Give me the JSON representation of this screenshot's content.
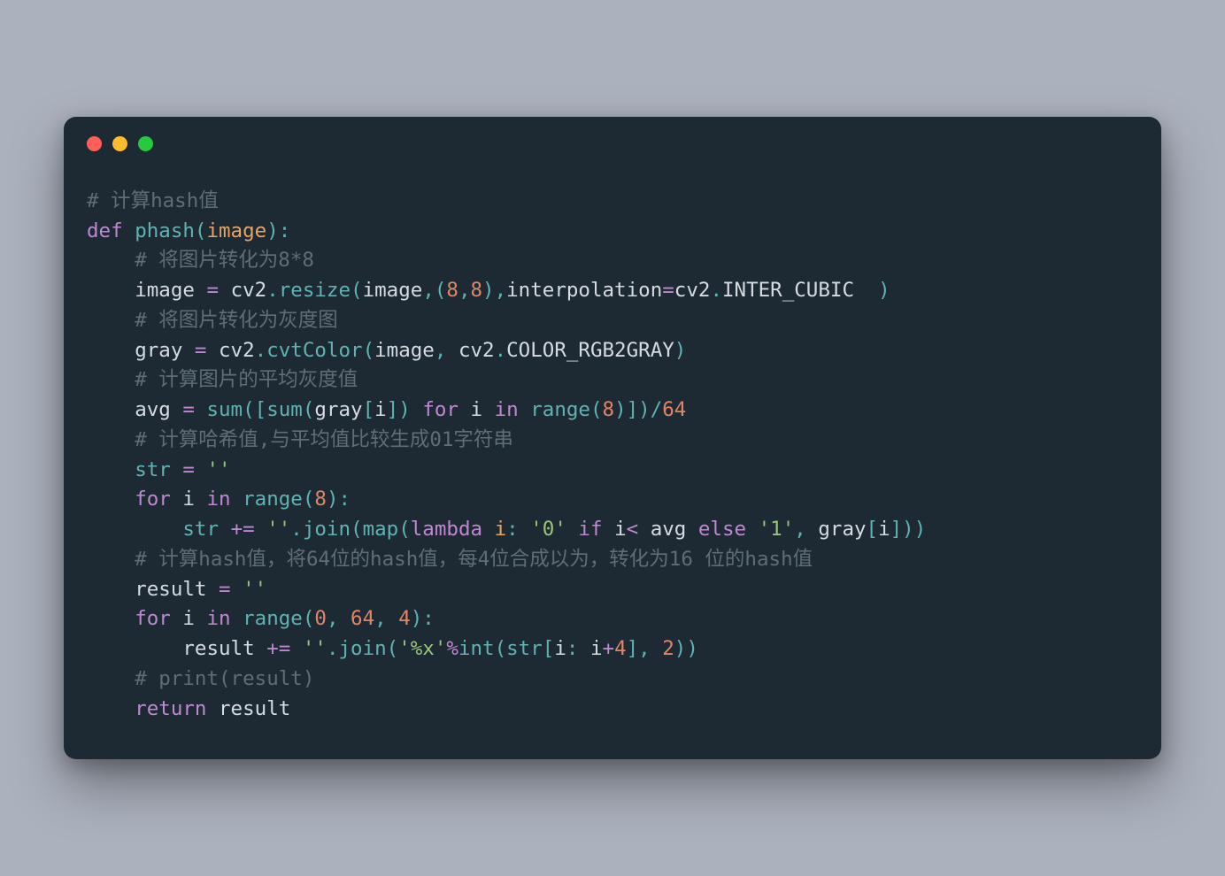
{
  "titlebar": {
    "buttons": [
      "close",
      "minimize",
      "zoom"
    ]
  },
  "code": {
    "lines": [
      [
        {
          "cls": "tok-comment",
          "t": "# 计算hash值"
        }
      ],
      [
        {
          "cls": "tok-keyword",
          "t": "def"
        },
        {
          "cls": "",
          "t": " "
        },
        {
          "cls": "tok-func",
          "t": "phash"
        },
        {
          "cls": "tok-punct",
          "t": "("
        },
        {
          "cls": "tok-param",
          "t": "image"
        },
        {
          "cls": "tok-punct",
          "t": "):"
        }
      ],
      [
        {
          "cls": "",
          "t": "    "
        },
        {
          "cls": "tok-comment",
          "t": "# 将图片转化为8*8"
        }
      ],
      [
        {
          "cls": "",
          "t": "    "
        },
        {
          "cls": "tok-var",
          "t": "image"
        },
        {
          "cls": "",
          "t": " "
        },
        {
          "cls": "tok-op",
          "t": "="
        },
        {
          "cls": "",
          "t": " "
        },
        {
          "cls": "tok-var",
          "t": "cv2"
        },
        {
          "cls": "tok-punct",
          "t": "."
        },
        {
          "cls": "tok-member",
          "t": "resize"
        },
        {
          "cls": "tok-punct",
          "t": "("
        },
        {
          "cls": "tok-var",
          "t": "image"
        },
        {
          "cls": "tok-punct",
          "t": ",("
        },
        {
          "cls": "tok-num",
          "t": "8"
        },
        {
          "cls": "tok-punct",
          "t": ","
        },
        {
          "cls": "tok-num",
          "t": "8"
        },
        {
          "cls": "tok-punct",
          "t": "),"
        },
        {
          "cls": "tok-var",
          "t": "interpolation"
        },
        {
          "cls": "tok-op",
          "t": "="
        },
        {
          "cls": "tok-var",
          "t": "cv2"
        },
        {
          "cls": "tok-punct",
          "t": "."
        },
        {
          "cls": "tok-var",
          "t": "INTER_CUBIC"
        },
        {
          "cls": "",
          "t": "  "
        },
        {
          "cls": "tok-punct",
          "t": ")"
        }
      ],
      [
        {
          "cls": "",
          "t": "    "
        },
        {
          "cls": "tok-comment",
          "t": "# 将图片转化为灰度图"
        }
      ],
      [
        {
          "cls": "",
          "t": "    "
        },
        {
          "cls": "tok-var",
          "t": "gray"
        },
        {
          "cls": "",
          "t": " "
        },
        {
          "cls": "tok-op",
          "t": "="
        },
        {
          "cls": "",
          "t": " "
        },
        {
          "cls": "tok-var",
          "t": "cv2"
        },
        {
          "cls": "tok-punct",
          "t": "."
        },
        {
          "cls": "tok-member",
          "t": "cvtColor"
        },
        {
          "cls": "tok-punct",
          "t": "("
        },
        {
          "cls": "tok-var",
          "t": "image"
        },
        {
          "cls": "tok-punct",
          "t": ", "
        },
        {
          "cls": "tok-var",
          "t": "cv2"
        },
        {
          "cls": "tok-punct",
          "t": "."
        },
        {
          "cls": "tok-var",
          "t": "COLOR_RGB2GRAY"
        },
        {
          "cls": "tok-punct",
          "t": ")"
        }
      ],
      [
        {
          "cls": "",
          "t": "    "
        },
        {
          "cls": "tok-comment",
          "t": "# 计算图片的平均灰度值"
        }
      ],
      [
        {
          "cls": "",
          "t": "    "
        },
        {
          "cls": "tok-var",
          "t": "avg"
        },
        {
          "cls": "",
          "t": " "
        },
        {
          "cls": "tok-op",
          "t": "="
        },
        {
          "cls": "",
          "t": " "
        },
        {
          "cls": "tok-builtin",
          "t": "sum"
        },
        {
          "cls": "tok-punct",
          "t": "(["
        },
        {
          "cls": "tok-builtin",
          "t": "sum"
        },
        {
          "cls": "tok-punct",
          "t": "("
        },
        {
          "cls": "tok-var",
          "t": "gray"
        },
        {
          "cls": "tok-punct",
          "t": "["
        },
        {
          "cls": "tok-var",
          "t": "i"
        },
        {
          "cls": "tok-punct",
          "t": "]) "
        },
        {
          "cls": "tok-keyword",
          "t": "for"
        },
        {
          "cls": "",
          "t": " "
        },
        {
          "cls": "tok-var",
          "t": "i"
        },
        {
          "cls": "",
          "t": " "
        },
        {
          "cls": "tok-keyword",
          "t": "in"
        },
        {
          "cls": "",
          "t": " "
        },
        {
          "cls": "tok-builtin",
          "t": "range"
        },
        {
          "cls": "tok-punct",
          "t": "("
        },
        {
          "cls": "tok-num",
          "t": "8"
        },
        {
          "cls": "tok-punct",
          "t": ")])/"
        },
        {
          "cls": "tok-num",
          "t": "64"
        }
      ],
      [
        {
          "cls": "",
          "t": "    "
        },
        {
          "cls": "tok-comment",
          "t": "# 计算哈希值,与平均值比较生成01字符串"
        }
      ],
      [
        {
          "cls": "",
          "t": "    "
        },
        {
          "cls": "tok-builtin",
          "t": "str"
        },
        {
          "cls": "",
          "t": " "
        },
        {
          "cls": "tok-op",
          "t": "="
        },
        {
          "cls": "",
          "t": " "
        },
        {
          "cls": "tok-str",
          "t": "''"
        }
      ],
      [
        {
          "cls": "",
          "t": "    "
        },
        {
          "cls": "tok-keyword",
          "t": "for"
        },
        {
          "cls": "",
          "t": " "
        },
        {
          "cls": "tok-var",
          "t": "i"
        },
        {
          "cls": "",
          "t": " "
        },
        {
          "cls": "tok-keyword",
          "t": "in"
        },
        {
          "cls": "",
          "t": " "
        },
        {
          "cls": "tok-builtin",
          "t": "range"
        },
        {
          "cls": "tok-punct",
          "t": "("
        },
        {
          "cls": "tok-num",
          "t": "8"
        },
        {
          "cls": "tok-punct",
          "t": "):"
        }
      ],
      [
        {
          "cls": "",
          "t": "        "
        },
        {
          "cls": "tok-builtin",
          "t": "str"
        },
        {
          "cls": "",
          "t": " "
        },
        {
          "cls": "tok-op",
          "t": "+="
        },
        {
          "cls": "",
          "t": " "
        },
        {
          "cls": "tok-str",
          "t": "''"
        },
        {
          "cls": "tok-punct",
          "t": "."
        },
        {
          "cls": "tok-member",
          "t": "join"
        },
        {
          "cls": "tok-punct",
          "t": "("
        },
        {
          "cls": "tok-builtin",
          "t": "map"
        },
        {
          "cls": "tok-punct",
          "t": "("
        },
        {
          "cls": "tok-keyword",
          "t": "lambda"
        },
        {
          "cls": "",
          "t": " "
        },
        {
          "cls": "tok-param",
          "t": "i"
        },
        {
          "cls": "tok-punct",
          "t": ": "
        },
        {
          "cls": "tok-str",
          "t": "'0'"
        },
        {
          "cls": "",
          "t": " "
        },
        {
          "cls": "tok-keyword",
          "t": "if"
        },
        {
          "cls": "",
          "t": " "
        },
        {
          "cls": "tok-var",
          "t": "i"
        },
        {
          "cls": "tok-op",
          "t": "<"
        },
        {
          "cls": "",
          "t": " "
        },
        {
          "cls": "tok-var",
          "t": "avg"
        },
        {
          "cls": "",
          "t": " "
        },
        {
          "cls": "tok-keyword",
          "t": "else"
        },
        {
          "cls": "",
          "t": " "
        },
        {
          "cls": "tok-str",
          "t": "'1'"
        },
        {
          "cls": "tok-punct",
          "t": ", "
        },
        {
          "cls": "tok-var",
          "t": "gray"
        },
        {
          "cls": "tok-punct",
          "t": "["
        },
        {
          "cls": "tok-var",
          "t": "i"
        },
        {
          "cls": "tok-punct",
          "t": "]))"
        }
      ],
      [
        {
          "cls": "",
          "t": "    "
        },
        {
          "cls": "tok-comment",
          "t": "# 计算hash值，将64位的hash值，每4位合成以为，转化为16 位的hash值"
        }
      ],
      [
        {
          "cls": "",
          "t": "    "
        },
        {
          "cls": "tok-var",
          "t": "result"
        },
        {
          "cls": "",
          "t": " "
        },
        {
          "cls": "tok-op",
          "t": "="
        },
        {
          "cls": "",
          "t": " "
        },
        {
          "cls": "tok-str",
          "t": "''"
        }
      ],
      [
        {
          "cls": "",
          "t": "    "
        },
        {
          "cls": "tok-keyword",
          "t": "for"
        },
        {
          "cls": "",
          "t": " "
        },
        {
          "cls": "tok-var",
          "t": "i"
        },
        {
          "cls": "",
          "t": " "
        },
        {
          "cls": "tok-keyword",
          "t": "in"
        },
        {
          "cls": "",
          "t": " "
        },
        {
          "cls": "tok-builtin",
          "t": "range"
        },
        {
          "cls": "tok-punct",
          "t": "("
        },
        {
          "cls": "tok-num",
          "t": "0"
        },
        {
          "cls": "tok-punct",
          "t": ", "
        },
        {
          "cls": "tok-num",
          "t": "64"
        },
        {
          "cls": "tok-punct",
          "t": ", "
        },
        {
          "cls": "tok-num",
          "t": "4"
        },
        {
          "cls": "tok-punct",
          "t": "):"
        }
      ],
      [
        {
          "cls": "",
          "t": "        "
        },
        {
          "cls": "tok-var",
          "t": "result"
        },
        {
          "cls": "",
          "t": " "
        },
        {
          "cls": "tok-op",
          "t": "+="
        },
        {
          "cls": "",
          "t": " "
        },
        {
          "cls": "tok-str",
          "t": "''"
        },
        {
          "cls": "tok-punct",
          "t": "."
        },
        {
          "cls": "tok-member",
          "t": "join"
        },
        {
          "cls": "tok-punct",
          "t": "("
        },
        {
          "cls": "tok-str",
          "t": "'%x'"
        },
        {
          "cls": "tok-op",
          "t": "%"
        },
        {
          "cls": "tok-builtin",
          "t": "int"
        },
        {
          "cls": "tok-punct",
          "t": "("
        },
        {
          "cls": "tok-builtin",
          "t": "str"
        },
        {
          "cls": "tok-punct",
          "t": "["
        },
        {
          "cls": "tok-var",
          "t": "i"
        },
        {
          "cls": "tok-punct",
          "t": ": "
        },
        {
          "cls": "tok-var",
          "t": "i"
        },
        {
          "cls": "tok-op",
          "t": "+"
        },
        {
          "cls": "tok-num",
          "t": "4"
        },
        {
          "cls": "tok-punct",
          "t": "], "
        },
        {
          "cls": "tok-num",
          "t": "2"
        },
        {
          "cls": "tok-punct",
          "t": "))"
        }
      ],
      [
        {
          "cls": "",
          "t": "    "
        },
        {
          "cls": "tok-comment",
          "t": "# print(result)"
        }
      ],
      [
        {
          "cls": "",
          "t": "    "
        },
        {
          "cls": "tok-keyword",
          "t": "return"
        },
        {
          "cls": "",
          "t": " "
        },
        {
          "cls": "tok-var",
          "t": "result"
        }
      ]
    ]
  }
}
